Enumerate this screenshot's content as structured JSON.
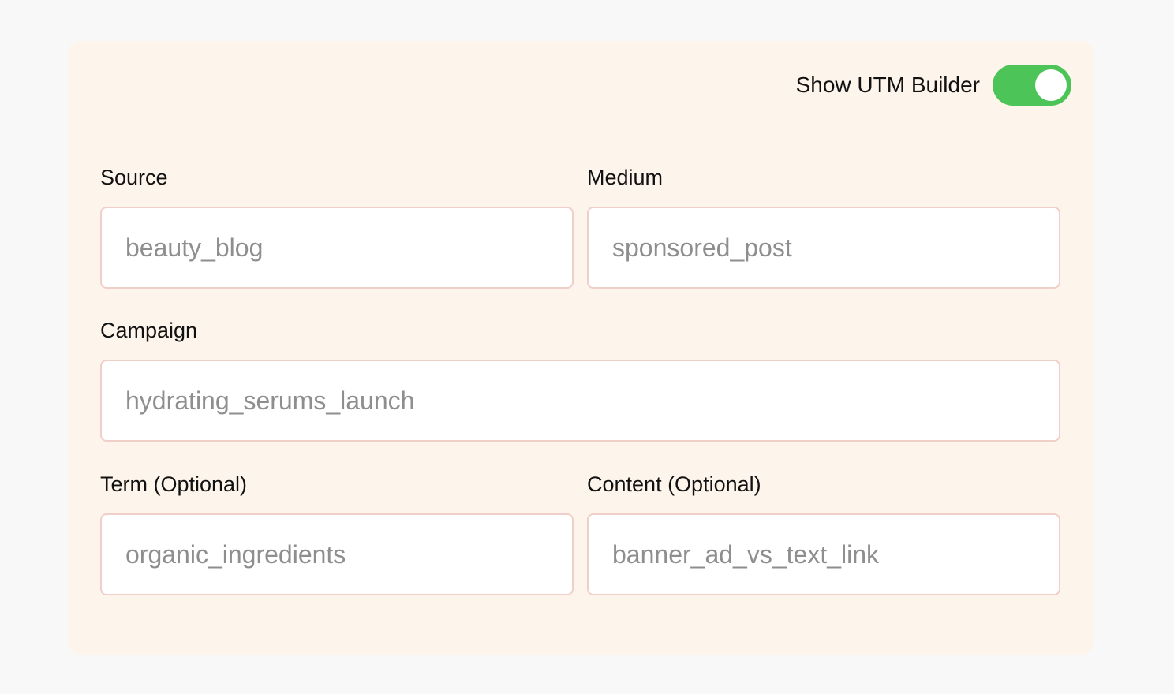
{
  "toggle": {
    "label": "Show UTM Builder",
    "on": true,
    "on_color": "#4cc457"
  },
  "fields": {
    "source": {
      "label": "Source",
      "placeholder": "beauty_blog"
    },
    "medium": {
      "label": "Medium",
      "placeholder": "sponsored_post"
    },
    "campaign": {
      "label": "Campaign",
      "placeholder": "hydrating_serums_launch"
    },
    "term": {
      "label": "Term (Optional)",
      "placeholder": "organic_ingredients"
    },
    "content": {
      "label": "Content (Optional)",
      "placeholder": "banner_ad_vs_text_link"
    }
  },
  "colors": {
    "panel_background": "#fdf4ec",
    "input_border": "#f0cfc8",
    "placeholder_text": "#8e8e8e"
  }
}
